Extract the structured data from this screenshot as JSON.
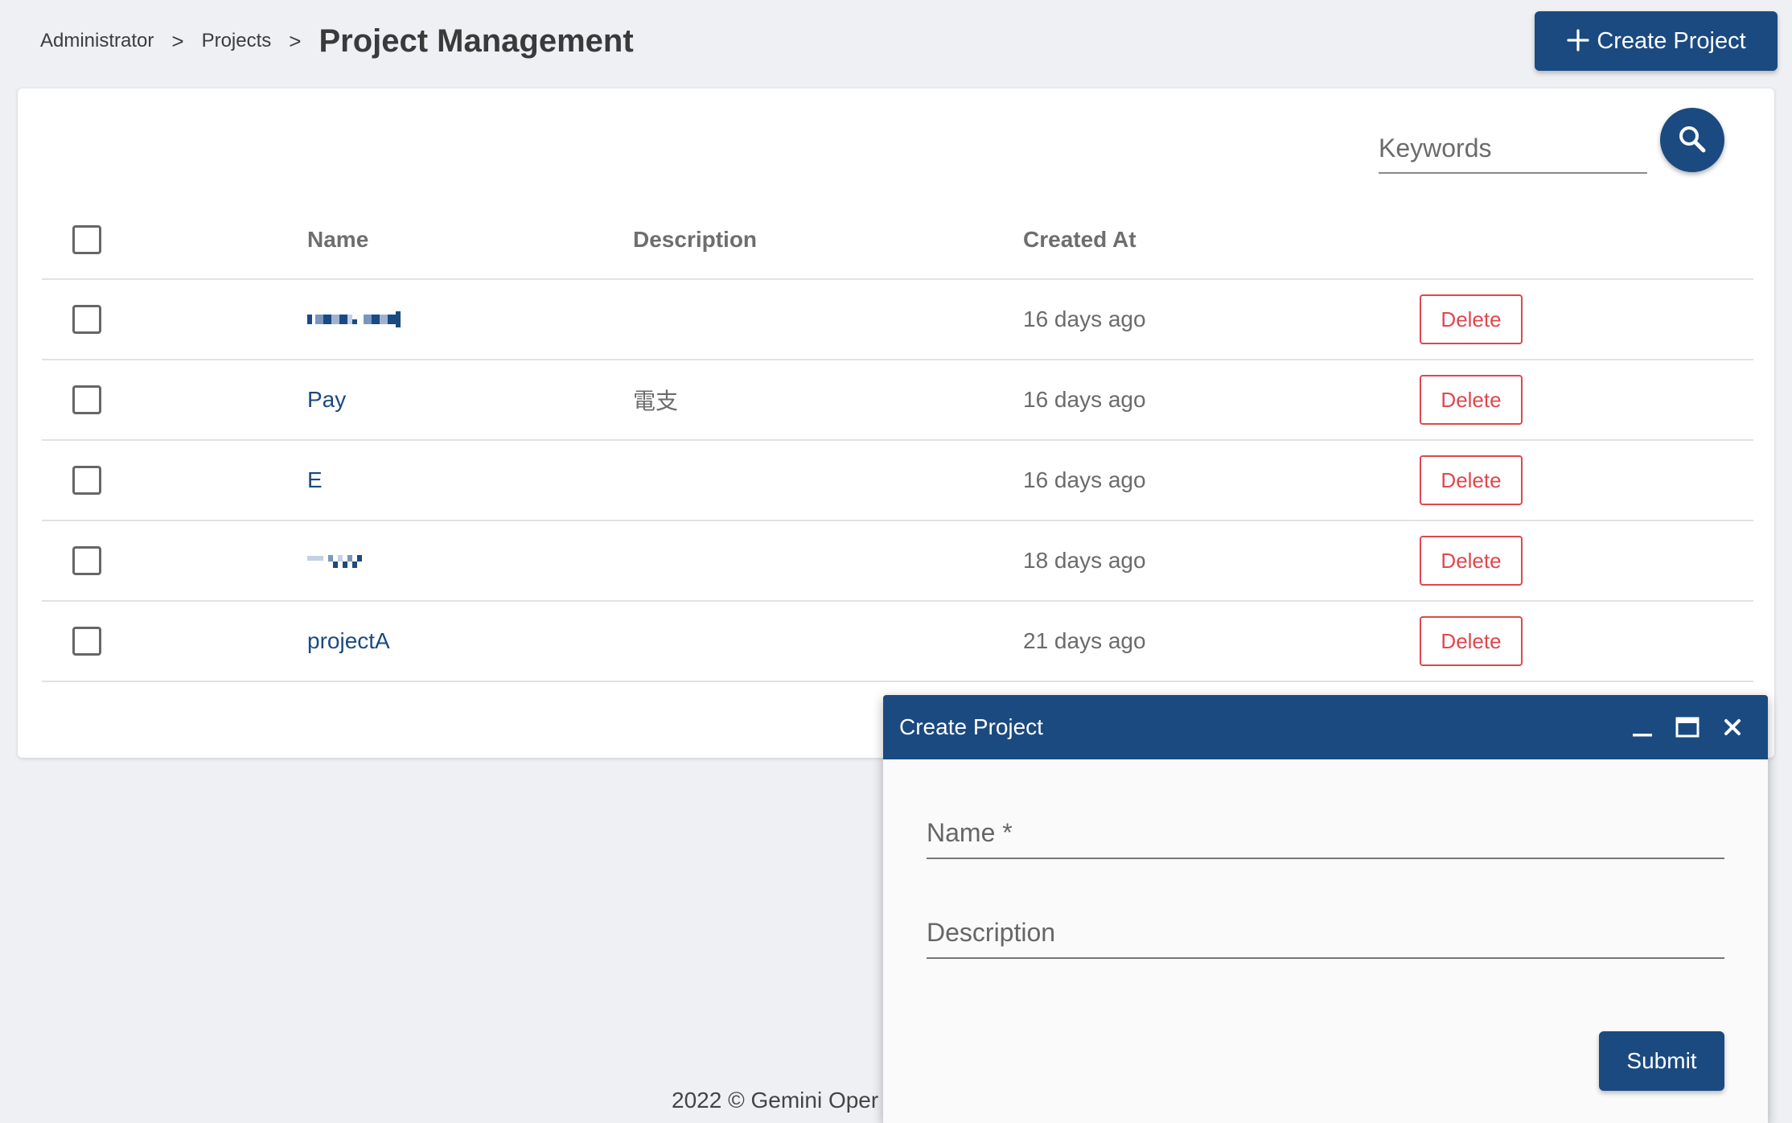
{
  "breadcrumb": {
    "items": [
      "Administrator",
      "Projects"
    ],
    "separator": ">",
    "current": "Project Management"
  },
  "header": {
    "create_button_label": "Create Project",
    "create_button_icon": "plus-icon"
  },
  "search": {
    "placeholder": "Keywords",
    "button_icon": "search-icon"
  },
  "table": {
    "columns": {
      "name": "Name",
      "description": "Description",
      "created_at": "Created At"
    },
    "rows": [
      {
        "name": "",
        "name_redacted": true,
        "description": "",
        "created_at": "16 days ago",
        "action": "Delete"
      },
      {
        "name": "Pay",
        "description": "電支",
        "created_at": "16 days ago",
        "action": "Delete"
      },
      {
        "name": "E",
        "description": "",
        "created_at": "16 days ago",
        "action": "Delete"
      },
      {
        "name": "",
        "name_redacted": true,
        "description": "",
        "created_at": "18 days ago",
        "action": "Delete"
      },
      {
        "name": "projectA",
        "description": "",
        "created_at": "21 days ago",
        "action": "Delete"
      }
    ]
  },
  "footer": {
    "text": "2022 © Gemini Oper"
  },
  "dialog": {
    "title": "Create Project",
    "controls": [
      "minimize-icon",
      "maximize-icon",
      "close-icon"
    ],
    "fields": [
      {
        "label": "Name *",
        "value": ""
      },
      {
        "label": "Description",
        "value": ""
      }
    ],
    "submit_label": "Submit"
  },
  "colors": {
    "primary": "#1b4a80",
    "danger": "#e0474c",
    "background": "#eef0f4"
  }
}
